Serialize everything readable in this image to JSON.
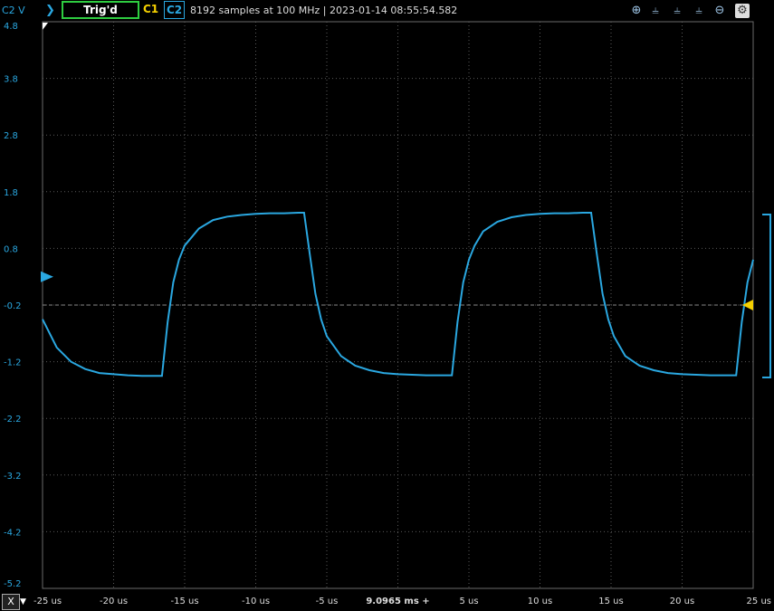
{
  "toolbar": {
    "channel_label": "C2 V",
    "trigger_status": "Trig'd",
    "channel1": "C1",
    "channel2": "C2",
    "acquisition_info": "8192 samples at 100 MHz | 2023-01-14 08:55:54.582",
    "icons": [
      "zoom-in-icon",
      "cursor-a-icon",
      "cursor-b-icon",
      "cursor-c-icon",
      "zoom-out-icon",
      "settings-icon"
    ]
  },
  "footer": {
    "axis_button": "X",
    "dropdown_glyph": "▼",
    "time_position": "9.0965 ms +"
  },
  "colors": {
    "trace": "#2aa7e0",
    "trigger_marker": "#f5d000",
    "grid": "#5a5a5a",
    "background": "#000000"
  },
  "chart_data": {
    "type": "line",
    "xlabel": "",
    "ylabel": "C2 V",
    "xlim": [
      -25,
      25
    ],
    "ylim": [
      -5.2,
      4.8
    ],
    "x_ticks": [
      -25,
      -20,
      -15,
      -10,
      -5,
      0,
      5,
      10,
      15,
      20,
      25
    ],
    "x_tick_labels": [
      "-25 us",
      "-20 us",
      "-15 us",
      "-10 us",
      "-5 us",
      "9.0965 ms +",
      "5 us",
      "10 us",
      "15 us",
      "20 us",
      "25 us"
    ],
    "y_ticks": [
      4.8,
      3.8,
      2.8,
      1.8,
      0.8,
      -0.2,
      -1.2,
      -2.2,
      -3.2,
      -4.2,
      -5.2
    ],
    "y_tick_labels": [
      "4.8",
      "3.8",
      "2.8",
      "1.8",
      "0.8",
      "-0.2",
      "-1.2",
      "-2.2",
      "-3.2",
      "-4.2",
      "-5.2"
    ],
    "trigger_level": -0.2,
    "grid": true,
    "series": [
      {
        "x": [
          -25,
          -24,
          -23,
          -22,
          -21,
          -20,
          -19,
          -18,
          -17,
          -16.6,
          -16.2,
          -15.8,
          -15.4,
          -15,
          -14,
          -13,
          -12,
          -11,
          -10,
          -9,
          -8,
          -7,
          -6.6,
          -6.2,
          -5.8,
          -5.4,
          -5,
          -4,
          -3,
          -2,
          -1,
          0,
          1,
          2,
          3,
          3.8,
          4.2,
          4.6,
          5,
          5.4,
          6,
          7,
          8,
          9,
          10,
          11,
          12,
          13,
          13.6,
          14,
          14.4,
          14.8,
          15.2,
          16,
          17,
          18,
          19,
          20,
          21,
          22,
          23,
          23.8,
          24.2,
          24.6,
          25
        ],
        "y": [
          -0.45,
          -0.95,
          -1.2,
          -1.33,
          -1.4,
          -1.42,
          -1.44,
          -1.45,
          -1.45,
          -1.45,
          -0.5,
          0.2,
          0.6,
          0.85,
          1.15,
          1.3,
          1.36,
          1.39,
          1.41,
          1.42,
          1.42,
          1.43,
          1.43,
          0.7,
          0.0,
          -0.45,
          -0.75,
          -1.1,
          -1.27,
          -1.35,
          -1.4,
          -1.42,
          -1.43,
          -1.44,
          -1.44,
          -1.44,
          -0.5,
          0.2,
          0.6,
          0.85,
          1.1,
          1.27,
          1.35,
          1.39,
          1.41,
          1.42,
          1.42,
          1.43,
          1.43,
          0.7,
          0.0,
          -0.45,
          -0.75,
          -1.1,
          -1.27,
          -1.35,
          -1.4,
          -1.42,
          -1.43,
          -1.44,
          -1.44,
          -1.44,
          -0.5,
          0.2,
          0.6
        ]
      }
    ]
  }
}
